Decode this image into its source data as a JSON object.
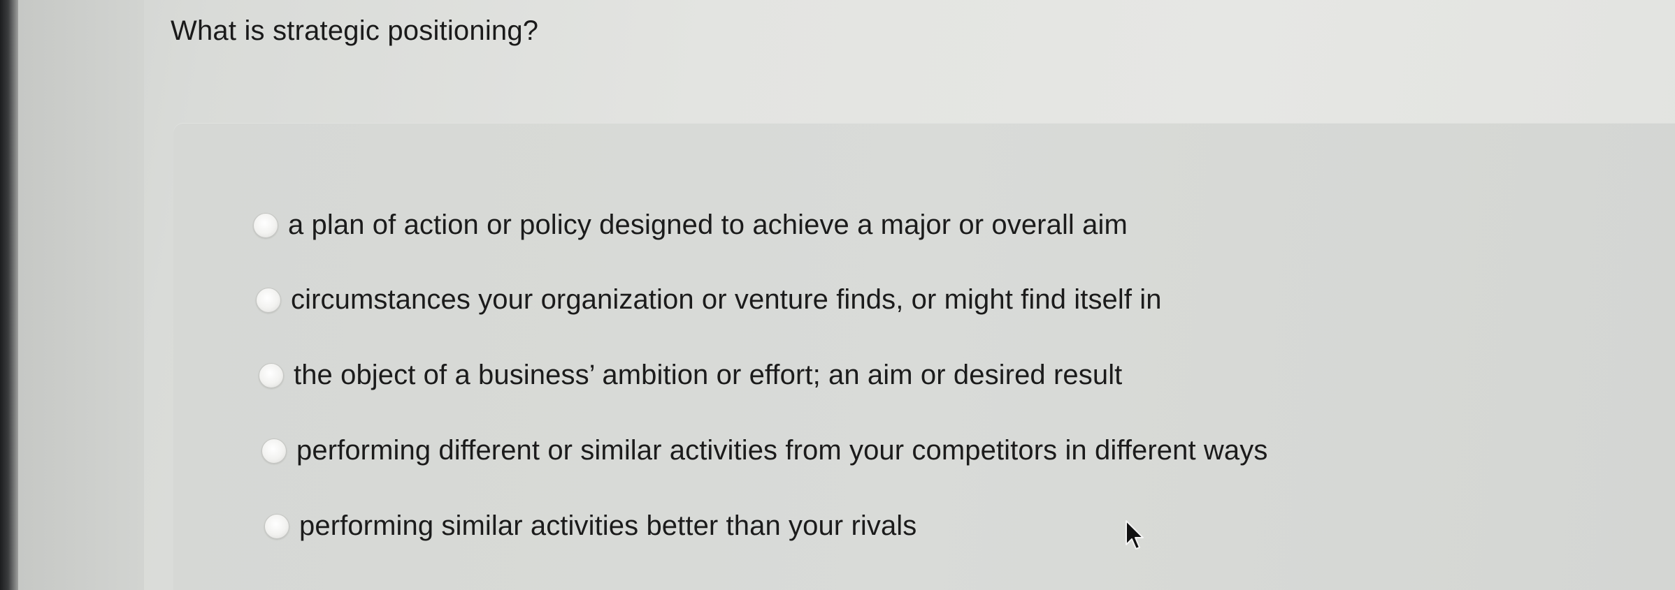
{
  "question": {
    "text": "What is strategic positioning?"
  },
  "options": [
    {
      "label": "a plan of action or policy designed to achieve a major or overall aim",
      "selected": false
    },
    {
      "label": "circumstances your organization or venture finds, or might find itself in",
      "selected": false
    },
    {
      "label": "the object of a business’ ambition or effort; an aim or desired result",
      "selected": false
    },
    {
      "label": "performing different or similar activities from your competitors in different ways",
      "selected": false
    },
    {
      "label": "performing similar activities better than your rivals",
      "selected": false
    }
  ],
  "icons": {
    "radio": "radio-button-icon",
    "cursor": "mouse-pointer-icon"
  }
}
